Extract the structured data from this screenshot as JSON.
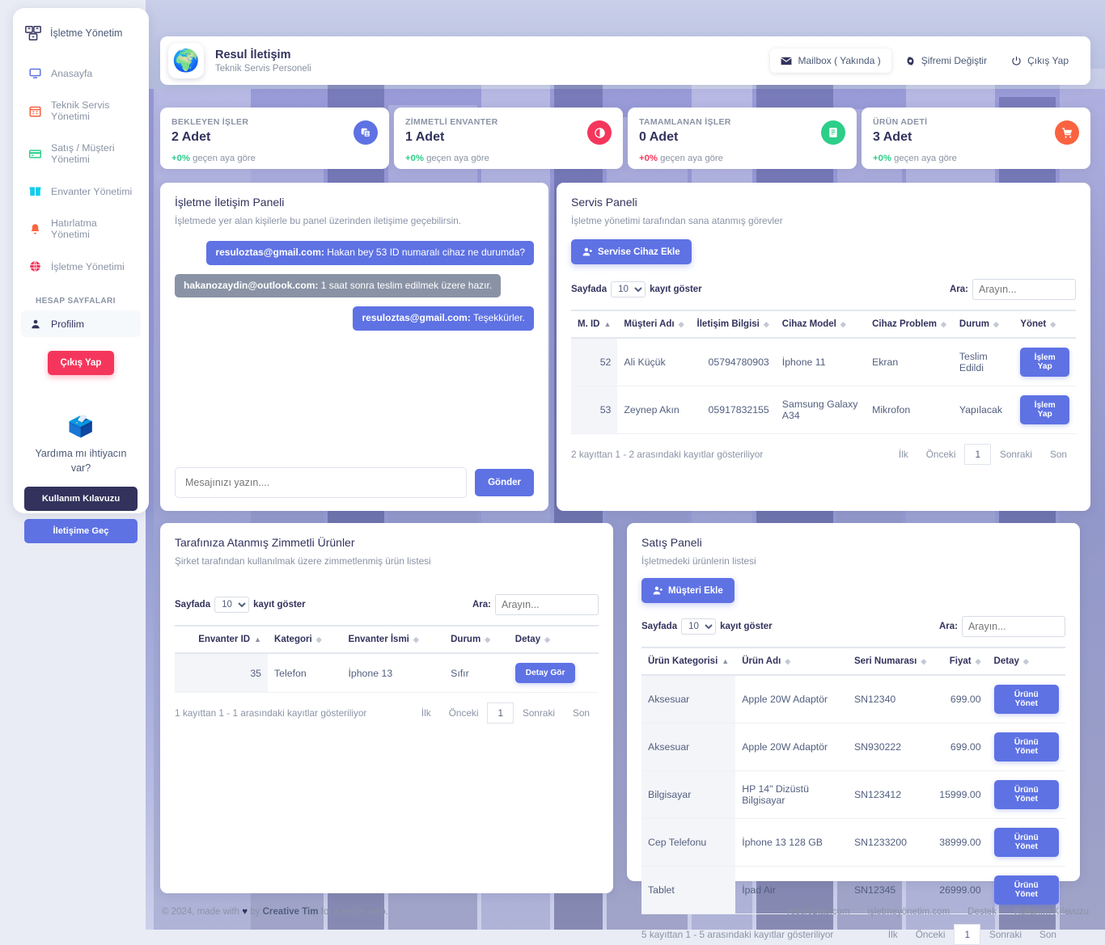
{
  "sidebar": {
    "brand": "İşletme Yönetim",
    "items": [
      {
        "label": "Anasayfa",
        "icon": "monitor-icon",
        "color": "#5e72e4"
      },
      {
        "label": "Teknik Servis Yönetimi",
        "icon": "calendar-icon",
        "color": "#f5603e"
      },
      {
        "label": "Satış / Müşteri Yönetimi",
        "icon": "credit-card-icon",
        "color": "#2dce89"
      },
      {
        "label": "Envanter Yönetimi",
        "icon": "box-icon",
        "color": "#11cdef"
      },
      {
        "label": "Hatırlatma Yönetimi",
        "icon": "bell-icon",
        "color": "#fb6340"
      },
      {
        "label": "İşletme Yönetimi",
        "icon": "globe-icon",
        "color": "#f5365c"
      }
    ],
    "section_label": "HESAP SAYFALARI",
    "profile_label": "Profilim",
    "logout_label": "Çıkış Yap",
    "help_title": "Yardıma mı ihtiyacın var?",
    "help_doc_label": "Kullanım Kılavuzu",
    "help_contact_label": "İletişime Geç"
  },
  "header": {
    "name": "Resul İletişim",
    "role": "Teknik Servis Personeli",
    "actions": [
      {
        "label": "Mailbox ( Yakında )",
        "icon": "mail-icon",
        "active": true
      },
      {
        "label": "Şifremi Değiştir",
        "icon": "gear-icon",
        "active": false
      },
      {
        "label": "Çıkış Yap",
        "icon": "power-icon",
        "active": false
      }
    ]
  },
  "stats": [
    {
      "label": "BEKLEYEN İŞLER",
      "value": "2 Adet",
      "delta": "+0%",
      "delta_color": "#2dce89",
      "note": "geçen aya göre",
      "icon": "copy-icon",
      "icon_color": "#5e72e4"
    },
    {
      "label": "ZİMMETLİ ENVANTER",
      "value": "1 Adet",
      "delta": "+0%",
      "delta_color": "#2dce89",
      "note": "geçen aya göre",
      "icon": "chart-pie-icon",
      "icon_color": "#f5365c"
    },
    {
      "label": "TAMAMLANAN İŞLER",
      "value": "0 Adet",
      "delta": "+0%",
      "delta_color": "#f5365c",
      "note": "geçen aya göre",
      "icon": "clipboard-icon",
      "icon_color": "#2dce89"
    },
    {
      "label": "ÜRÜN ADETİ",
      "value": "3 Adet",
      "delta": "+0%",
      "delta_color": "#2dce89",
      "note": "geçen aya göre",
      "icon": "cart-icon",
      "icon_color": "#fb6340"
    }
  ],
  "chat": {
    "title": "İşletme İletişim Paneli",
    "subtitle": "İşletmede yer alan kişilerle bu panel üzerinden iletişime geçebilirsin.",
    "messages": [
      {
        "sender": "resuloztas@gmail.com:",
        "text": " Hakan bey 53 ID numaralı cihaz ne durumda?",
        "side": "right"
      },
      {
        "sender": "hakanozaydin@outlook.com:",
        "text": " 1 saat sonra teslim edilmek üzere hazır.",
        "side": "left"
      },
      {
        "sender": "resuloztas@gmail.com:",
        "text": " Teşekkürler.",
        "side": "right"
      }
    ],
    "input_placeholder": "Mesajınızı yazın....",
    "send_label": "Gönder"
  },
  "service": {
    "title": "Servis Paneli",
    "subtitle": "İşletme yönetimi tarafından sana atanmış görevler",
    "add_label": "Servise Cihaz Ekle",
    "page_prefix": "Sayfada",
    "page_suffix": "kayıt göster",
    "page_size": "10",
    "search_label": "Ara:",
    "search_placeholder": "Arayın...",
    "columns": [
      "M. ID",
      "Müşteri Adı",
      "İletişim Bilgisi",
      "Cihaz Model",
      "Cihaz Problem",
      "Durum",
      "Yönet"
    ],
    "rows": [
      {
        "id": "52",
        "customer": "Ali Küçük",
        "contact": "05794780903",
        "model": "İphone 11",
        "problem": "Ekran",
        "status": "Teslim Edildi",
        "action": "İşlem Yap"
      },
      {
        "id": "53",
        "customer": "Zeynep Akın",
        "contact": "05917832155",
        "model": "Samsung Galaxy A34",
        "problem": "Mikrofon",
        "status": "Yapılacak",
        "action": "İşlem Yap"
      }
    ],
    "info": "2 kayıttan 1 - 2 arasındaki kayıtlar gösteriliyor",
    "pager": {
      "first": "İlk",
      "prev": "Önceki",
      "current": "1",
      "next": "Sonraki",
      "last": "Son"
    }
  },
  "assigned": {
    "title": "Tarafınıza Atanmış Zimmetli Ürünler",
    "subtitle": "Şirket tarafından kullanılmak üzere zimmetlenmiş ürün listesi",
    "page_prefix": "Sayfada",
    "page_suffix": "kayıt göster",
    "page_size": "10",
    "search_label": "Ara:",
    "search_placeholder": "Arayın...",
    "columns": [
      "Envanter ID",
      "Kategori",
      "Envanter İsmi",
      "Durum",
      "Detay"
    ],
    "rows": [
      {
        "id": "35",
        "category": "Telefon",
        "name": "İphone 13",
        "status": "Sıfır",
        "action": "Detay Gör"
      }
    ],
    "info": "1 kayıttan 1 - 1 arasındaki kayıtlar gösteriliyor",
    "pager": {
      "first": "İlk",
      "prev": "Önceki",
      "current": "1",
      "next": "Sonraki",
      "last": "Son"
    }
  },
  "sales": {
    "title": "Satış Paneli",
    "subtitle": "İşletmedeki ürünlerin listesi",
    "add_label": "Müşteri Ekle",
    "page_prefix": "Sayfada",
    "page_suffix": "kayıt göster",
    "page_size": "10",
    "search_label": "Ara:",
    "search_placeholder": "Arayın...",
    "columns": [
      "Ürün Kategorisi",
      "Ürün Adı",
      "Seri Numarası",
      "Fiyat",
      "Detay"
    ],
    "rows": [
      {
        "category": "Aksesuar",
        "name": "Apple 20W Adaptör",
        "serial": "SN12340",
        "price": "699.00",
        "action": "Ürünü Yönet"
      },
      {
        "category": "Aksesuar",
        "name": "Apple 20W Adaptör",
        "serial": "SN930222",
        "price": "699.00",
        "action": "Ürünü Yönet"
      },
      {
        "category": "Bilgisayar",
        "name": "HP 14\" Dizüstü Bilgisayar",
        "serial": "SN123412",
        "price": "15999.00",
        "action": "Ürünü Yönet"
      },
      {
        "category": "Cep Telefonu",
        "name": "İphone 13 128 GB",
        "serial": "SN1233200",
        "price": "38999.00",
        "action": "Ürünü Yönet"
      },
      {
        "category": "Tablet",
        "name": "İpad Air",
        "serial": "SN12345",
        "price": "26999.00",
        "action": "Ürünü Yönet"
      }
    ],
    "info": "5 kayıttan 1 - 5 arasındaki kayıtlar gösteriliyor",
    "pager": {
      "first": "İlk",
      "prev": "Önceki",
      "current": "1",
      "next": "Sonraki",
      "last": "Son"
    }
  },
  "footer": {
    "copyright_pre": "© 2024, made with ",
    "heart": "♥",
    "copyright_mid": " by ",
    "brand": "Creative Tim",
    "copyright_post": " for a better web.",
    "links": [
      "resuloztas.com",
      "işletmeyönetim.com",
      "Destek",
      "Kullanım Kılavuzu"
    ]
  }
}
